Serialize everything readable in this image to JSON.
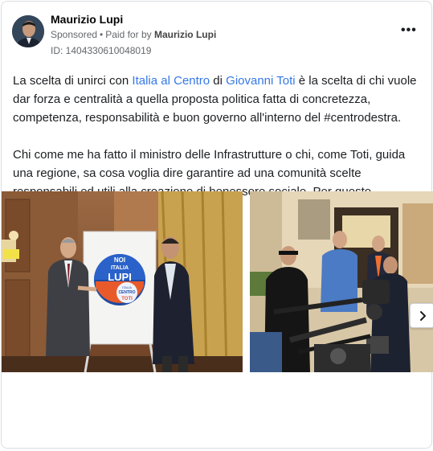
{
  "post": {
    "page_name": "Maurizio Lupi",
    "sponsored": "Sponsored",
    "paid_for_prefix": "Paid for by",
    "paid_for_name": "Maurizio Lupi",
    "library_id": "ID: 1404330610048019",
    "more_label": "•••"
  },
  "body": {
    "p1_a": "La scelta di unirci con ",
    "p1_link1": "Italia al Centro",
    "p1_b": " di ",
    "p1_link2": "Giovanni Toti",
    "p1_c": " è la scelta di chi vuole dar forza e centralità a quella proposta politica fatta di concretezza, competenza, responsabilità e buon governo all'interno del #centrodestra.",
    "p2": "Chi come me ha fatto il ministro delle Infrastrutture o chi, come Toti, guida una regione, sa cosa voglia dire garantire ad una comunità scelte responsabili ed utili alla creazione di benessere sociale. Per questo vogliamo assumerci la…"
  },
  "poster": {
    "line1": "NOI",
    "line2": "ITALIA",
    "line3": "LUPI",
    "line4": "ITALIA",
    "line5": "CENTRO",
    "line6": "TOTI"
  },
  "colors": {
    "link": "#3578e5",
    "muted": "#65676b",
    "border": "#dadde1"
  },
  "icons": {
    "more": "more-horizontal-icon",
    "next": "chevron-right-icon"
  }
}
